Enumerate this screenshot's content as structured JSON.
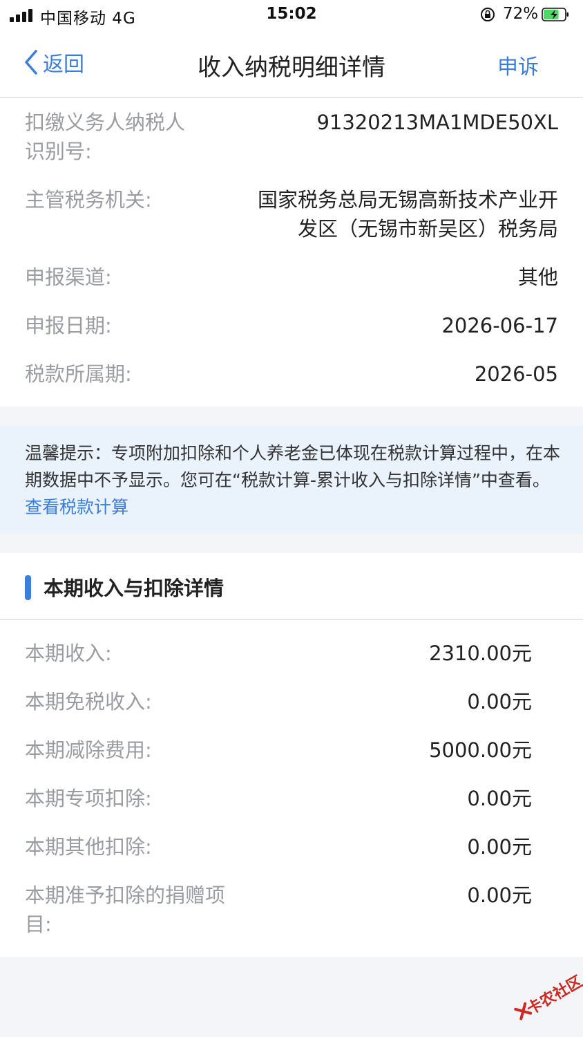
{
  "status_bar": {
    "carrier": "中国移动  4G",
    "time": "15:02",
    "battery_percent": "72%",
    "battery_level": 0.72,
    "charging": true
  },
  "nav": {
    "back_label": "返回",
    "title": "收入纳税明细详情",
    "action_label": "申诉"
  },
  "info": [
    {
      "label": "扣缴义务人纳税人",
      "label_line2": "识别号:",
      "value": "91320213MA1MDE50XL"
    },
    {
      "label": "主管税务机关:",
      "value_line1": "国家税务总局无锡高新技术产业开",
      "value_line2": "发区（无锡市新吴区）税务局"
    },
    {
      "label": "申报渠道:",
      "value": "其他"
    },
    {
      "label": "申报日期:",
      "value": "2026-06-17"
    },
    {
      "label": "税款所属期:",
      "value": "2026-05"
    }
  ],
  "tip": {
    "text": "温馨提示：专项附加扣除和个人养老金已体现在税款计算过程中，在本期数据中不予显示。您可在“税款计算-累计收入与扣除详情”中查看。",
    "link": "查看税款计算"
  },
  "section": {
    "title": "本期收入与扣除详情"
  },
  "details": [
    {
      "label": "本期收入:",
      "value": "2310.00元"
    },
    {
      "label": "本期免税收入:",
      "value": "0.00元"
    },
    {
      "label": "本期减除费用:",
      "value": "5000.00元"
    },
    {
      "label": "本期专项扣除:",
      "value": "0.00元"
    },
    {
      "label": "本期其他扣除:",
      "value": "0.00元"
    },
    {
      "label": "本期准予扣除的捐赠项",
      "label_line2": "目:",
      "value": "0.00元"
    }
  ],
  "colors": {
    "accent": "#3a7fe0",
    "label": "#9a9ca3",
    "tip_bg": "#eaf2fc",
    "battery": "#4cd964"
  },
  "watermark": {
    "text": "卡农社区"
  }
}
